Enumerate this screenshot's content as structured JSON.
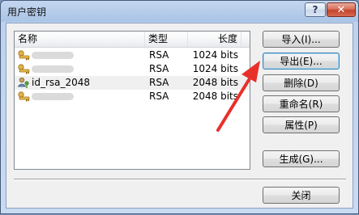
{
  "window": {
    "title": "用户密钥",
    "help_glyph": "?",
    "close_glyph": "✕"
  },
  "list": {
    "headers": [
      "名称",
      "类型",
      "长度"
    ],
    "rows": [
      {
        "name": "",
        "type": "RSA",
        "length": "1024 bits",
        "name_obscured": true
      },
      {
        "name": "",
        "type": "RSA",
        "length": "1024 bits",
        "name_obscured": true
      },
      {
        "name": "id_rsa_2048",
        "type": "RSA",
        "length": "2048 bits",
        "name_obscured": false
      },
      {
        "name": "",
        "type": "RSA",
        "length": "2048 bits",
        "name_obscured": true
      }
    ],
    "row_icon": "key-user-icon"
  },
  "buttons": {
    "import": "导入(I)...",
    "export": "导出(E)...",
    "delete": "删除(D)",
    "rename": "重命名(R)",
    "properties": "属性(P)",
    "generate": "生成(G)...",
    "close": "关闭"
  },
  "annotation": {
    "color": "#e8302a"
  }
}
